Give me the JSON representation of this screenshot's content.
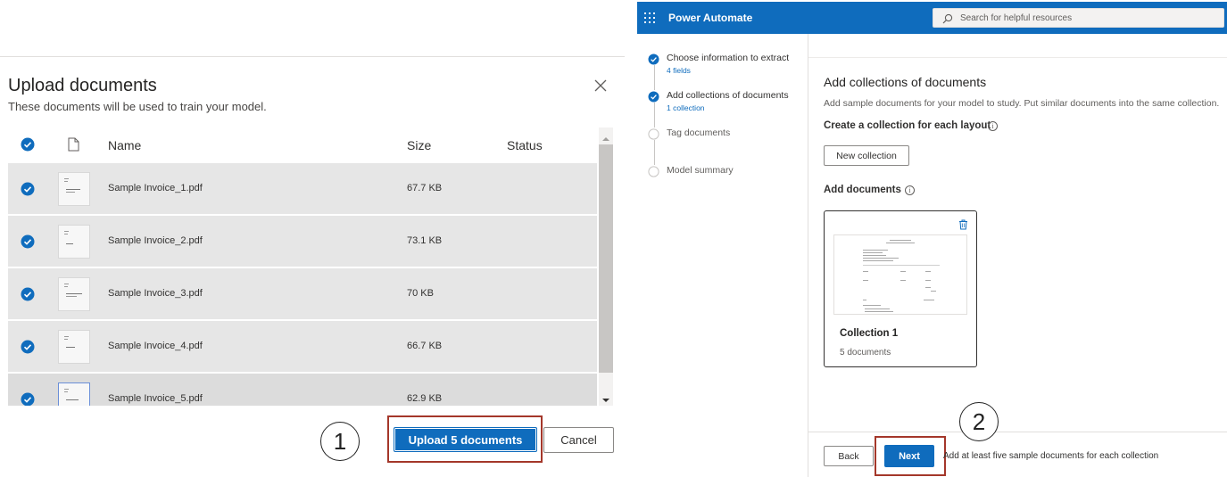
{
  "upload_dialog": {
    "title": "Upload documents",
    "subtitle": "These documents will be used to train your model.",
    "columns": {
      "name": "Name",
      "size": "Size",
      "status": "Status"
    },
    "files": [
      {
        "name": "Sample Invoice_1.pdf",
        "size": "67.7 KB",
        "status": ""
      },
      {
        "name": "Sample Invoice_2.pdf",
        "size": "73.1 KB",
        "status": ""
      },
      {
        "name": "Sample Invoice_3.pdf",
        "size": "70 KB",
        "status": ""
      },
      {
        "name": "Sample Invoice_4.pdf",
        "size": "66.7 KB",
        "status": ""
      },
      {
        "name": "Sample Invoice_5.pdf",
        "size": "62.9 KB",
        "status": ""
      }
    ],
    "upload_button": "Upload 5 documents",
    "cancel_button": "Cancel",
    "callout_number": "1"
  },
  "power_automate": {
    "app_name": "Power Automate",
    "search_placeholder": "Search for helpful resources",
    "steps": [
      {
        "label": "Choose information to extract",
        "sub": "4 fields",
        "state": "done"
      },
      {
        "label": "Add collections of documents",
        "sub": "1 collection",
        "state": "current"
      },
      {
        "label": "Tag documents",
        "sub": "",
        "state": "pending"
      },
      {
        "label": "Model summary",
        "sub": "",
        "state": "pending"
      }
    ],
    "section_title": "Add collections of documents",
    "section_description": "Add sample documents for your model to study. Put similar documents into the same collection.",
    "collection_heading": "Create a collection for each layout",
    "new_collection_button": "New collection",
    "add_documents_heading": "Add documents",
    "collection_card": {
      "title": "Collection 1",
      "count": "5 documents"
    },
    "back_button": "Back",
    "next_button": "Next",
    "footer_note": "Add at least five sample documents for each collection",
    "callout_number": "2"
  },
  "colors": {
    "brand_blue": "#0f6cbd",
    "highlight_red": "#a4372a",
    "row_gray": "#e6e6e6"
  }
}
